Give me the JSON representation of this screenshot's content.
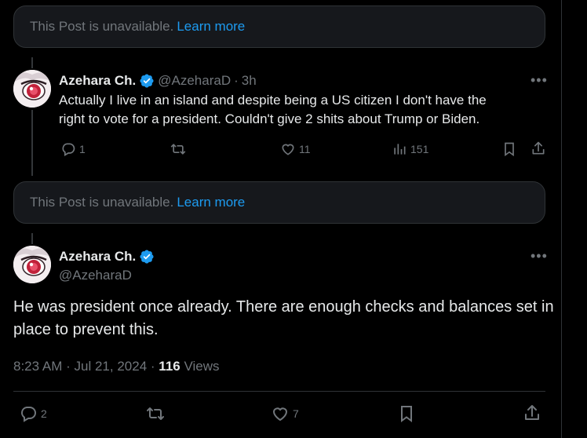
{
  "unavailable_notice": {
    "text": "This Post is unavailable.",
    "link": "Learn more"
  },
  "reply_post": {
    "display_name": "Azehara Ch.",
    "handle": "@AzeharaD",
    "separator": "·",
    "time": "3h",
    "text_line1": "Actually I live in an island and despite being a US citizen I don't have the",
    "text_line2": "right to vote for a president.  Couldn't give 2 shits about Trump or Biden.",
    "replies": "1",
    "likes": "11",
    "views": "151",
    "more_glyph": "•••"
  },
  "main_post": {
    "display_name": "Azehara Ch.",
    "handle": "@AzeharaD",
    "text": "He was president once already.  There are enough checks and balances set in place to prevent this.",
    "time": "8:23 AM",
    "date": "Jul 21, 2024",
    "dot": "·",
    "views_count": "116",
    "views_label": "Views",
    "replies": "2",
    "likes": "7",
    "more_glyph": "•••"
  },
  "colors": {
    "background": "#000000",
    "text": "#e7e9ea",
    "muted": "#71767b",
    "link": "#1d9bf0",
    "verified": "#1d9bf0",
    "border": "#2f3336"
  },
  "icons": [
    "verified-badge-icon",
    "reply-icon",
    "retweet-icon",
    "like-icon",
    "views-icon",
    "bookmark-icon",
    "share-icon",
    "more-icon"
  ]
}
